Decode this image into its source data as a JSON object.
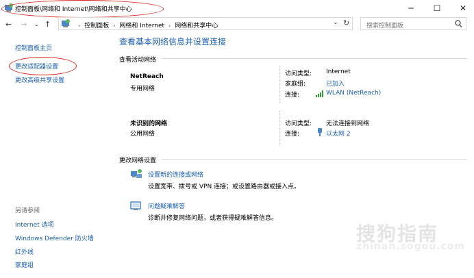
{
  "window": {
    "title": "控制面板\\网络和 Internet\\网络和共享中心",
    "minimize_label": "─",
    "maximize_label": "☐",
    "close_label": "✕"
  },
  "address_bar": {
    "crumbs": [
      "控制面板",
      "网络和 Internet",
      "网络和共享中心"
    ],
    "search_placeholder": "搜索控制面板"
  },
  "sidebar": {
    "items": [
      {
        "label": "控制面板主页"
      },
      {
        "label": "更改适配器设置"
      },
      {
        "label": "更改高级共享设置"
      }
    ],
    "see_also_title": "另请参阅",
    "see_also": [
      {
        "label": "Internet 选项"
      },
      {
        "label": "Windows Defender 防火墙"
      },
      {
        "label": "红外线"
      },
      {
        "label": "家庭组"
      }
    ]
  },
  "main": {
    "heading": "查看基本网络信息并设置连接",
    "active_networks_title": "查看活动网络",
    "networks": [
      {
        "name": "NetReach",
        "type": "专用网络",
        "access_type_label": "访问类型:",
        "access_type": "Internet",
        "homegroup_label": "家庭组:",
        "homegroup": "已加入",
        "connection_label": "连接:",
        "connection": "WLAN (NetReach)"
      },
      {
        "name": "未识别的网络",
        "type": "公用网络",
        "access_type_label": "访问类型:",
        "access_type": "无法连接到网络",
        "connection_label": "连接:",
        "connection": "以太网 2"
      }
    ],
    "change_settings_title": "更改网络设置",
    "tasks": [
      {
        "link": "设置新的连接或网络",
        "desc": "设置宽带、拨号或 VPN 连接；或设置路由器或接入点。"
      },
      {
        "link": "问题疑难解答",
        "desc": "诊断并修复网络问题，或者获得疑难解答信息。"
      }
    ]
  },
  "watermark": {
    "main": "搜狗指南",
    "sub": "zhinan.sogou.com"
  }
}
